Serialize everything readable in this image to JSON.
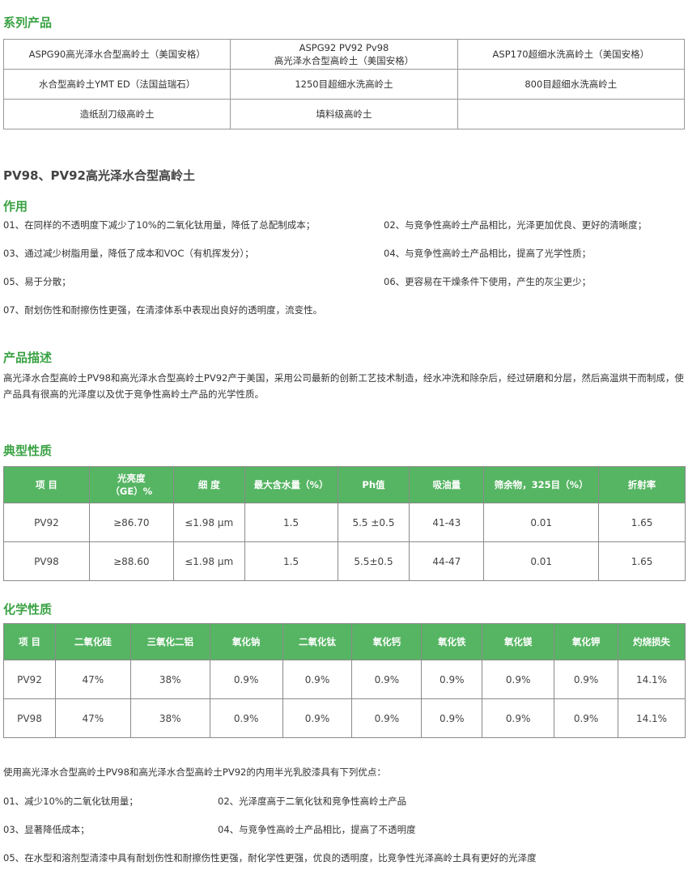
{
  "series_heading": "系列产品",
  "products": [
    [
      "ASPG90高光泽水合型高岭土（美国安格）",
      "ASPG92 PV92 Pv98\n高光泽水合型高岭土（美国安格）",
      "ASP170超细水洗高岭土（美国安格）"
    ],
    [
      "水合型高岭土YMT ED（法国益瑞石）",
      "1250目超细水洗高岭土",
      "800目超细水洗高岭土"
    ],
    [
      "造纸刮刀级高岭土",
      "填料级高岭土",
      ""
    ]
  ],
  "product_title": "PV98、PV92高光泽水合型高岭土",
  "uses_heading": "作用",
  "uses": [
    [
      "01、在同样的不透明度下减少了10%的二氧化钛用量，降低了总配制成本；",
      "02、与竞争性高岭土产品相比，光泽更加优良、更好的清晰度；"
    ],
    [
      "03、通过减少树脂用量，降低了成本和VOC（有机挥发分）；",
      "04、与竞争性高岭土产品相比，提高了光学性质；"
    ],
    [
      "05、易于分散；",
      "06、更容易在干燥条件下使用，产生的灰尘更少；"
    ],
    [
      "07、耐划伤性和耐擦伤性更强，在清漆体系中表现出良好的透明度，流变性。",
      ""
    ]
  ],
  "desc_heading": "产品描述",
  "description": "高光泽水合型高岭土PV98和高光泽水合型高岭土PV92产于美国，采用公司最新的创新工艺技术制造，经水冲洗和除杂后，经过研磨和分层，然后高温烘干而制成，使产品具有很高的光泽度以及优于竞争性高岭土产品的光学性质。",
  "typical_heading": "典型性质",
  "typical_headers": [
    "项 目",
    "光亮度\n（GE）%",
    "细 度",
    "最大含水量（%）",
    "Ph值",
    "吸油量",
    "筛余物，325目（%）",
    "折射率"
  ],
  "typical_rows": [
    [
      "PV92",
      "≥86.70",
      "≤1.98 µm",
      "1.5",
      "5.5 ±0.5",
      "41-43",
      "0.01",
      "1.65"
    ],
    [
      "PV98",
      "≥88.60",
      "≤1.98 µm",
      "1.5",
      "5.5±0.5",
      "44-47",
      "0.01",
      "1.65"
    ]
  ],
  "chem_heading": "化学性质",
  "chem_headers": [
    "项 目",
    "二氧化硅",
    "三氧化二铝",
    "氧化钠",
    "二氧化钛",
    "氧化钙",
    "氧化铁",
    "氧化镁",
    "氧化钾",
    "灼烧损失"
  ],
  "chem_rows": [
    [
      "PV92",
      "47%",
      "38%",
      "0.9%",
      "0.9%",
      "0.9%",
      "0.9%",
      "0.9%",
      "0.9%",
      "14.1%"
    ],
    [
      "PV98",
      "47%",
      "38%",
      "0.9%",
      "0.9%",
      "0.9%",
      "0.9%",
      "0.9%",
      "0.9%",
      "14.1%"
    ]
  ],
  "summary_intro": "使用高光泽水合型高岭土PV98和高光泽水合型高岭土PV92的内用半光乳胶漆具有下列优点：",
  "summary": [
    [
      "01、减少10%的二氧化钛用量；",
      "02、光泽度高于二氧化钛和竞争性高岭土产品"
    ],
    [
      "03、显著降低成本；",
      "04、与竞争性高岭土产品相比，提高了不透明度"
    ],
    [
      "05、在水型和溶剂型清漆中具有耐划伤性和耐擦伤性更强，耐化学性更强，优良的透明度，比竞争性光泽高岭土具有更好的光泽度",
      ""
    ]
  ]
}
